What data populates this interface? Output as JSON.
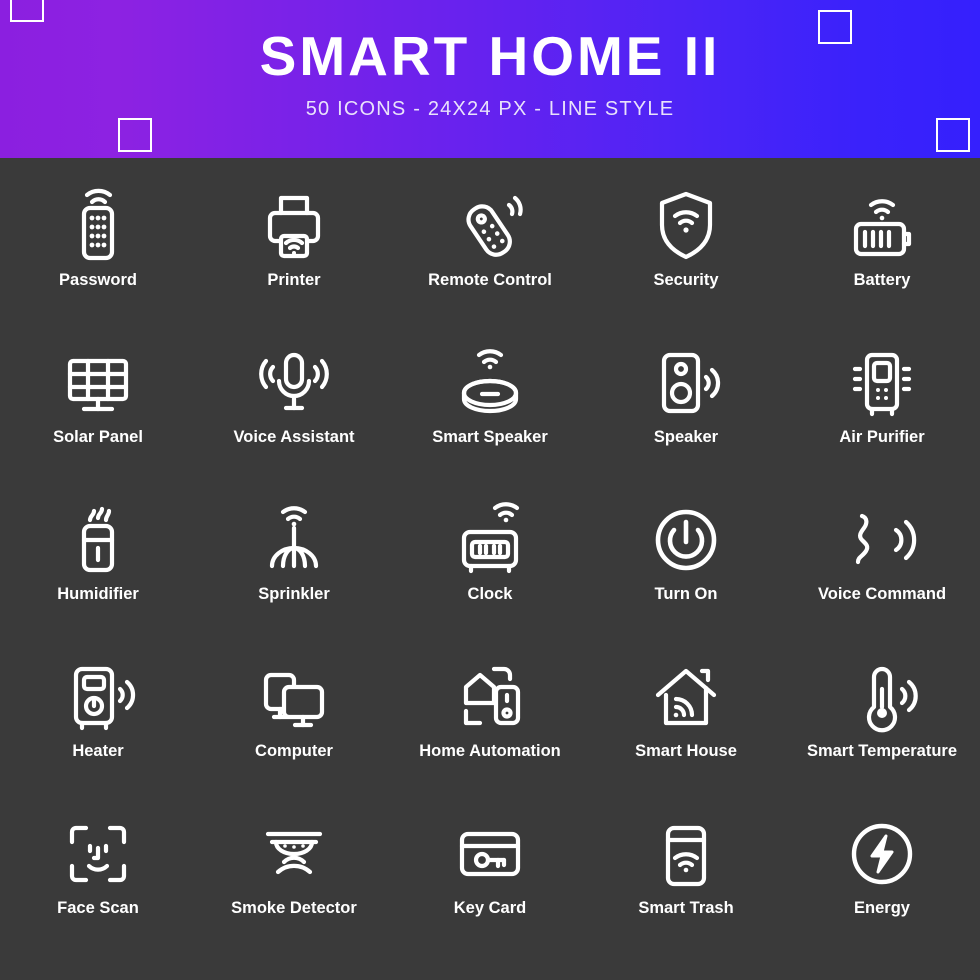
{
  "header": {
    "title": "SMART HOME II",
    "subtitle": "50 ICONS - 24X24 PX - LINE STYLE",
    "gradient_from": "#8b1fe0",
    "gradient_to": "#3520fd",
    "text_color": "#ffffff"
  },
  "theme": {
    "background": "#3a3a3a",
    "icon_color": "#ffffff",
    "label_color": "#ffffff"
  },
  "icons": [
    {
      "label": "Password",
      "icon": "password-icon"
    },
    {
      "label": "Printer",
      "icon": "printer-icon"
    },
    {
      "label": "Remote Control",
      "icon": "remote-control-icon"
    },
    {
      "label": "Security",
      "icon": "security-shield-icon"
    },
    {
      "label": "Battery",
      "icon": "battery-icon"
    },
    {
      "label": "Solar Panel",
      "icon": "solar-panel-icon"
    },
    {
      "label": "Voice Assistant",
      "icon": "voice-assistant-icon"
    },
    {
      "label": "Smart Speaker",
      "icon": "smart-speaker-icon"
    },
    {
      "label": "Speaker",
      "icon": "speaker-icon"
    },
    {
      "label": "Air Purifier",
      "icon": "air-purifier-icon"
    },
    {
      "label": "Humidifier",
      "icon": "humidifier-icon"
    },
    {
      "label": "Sprinkler",
      "icon": "sprinkler-icon"
    },
    {
      "label": "Clock",
      "icon": "clock-icon"
    },
    {
      "label": "Turn On",
      "icon": "power-icon"
    },
    {
      "label": "Voice Command",
      "icon": "voice-command-icon"
    },
    {
      "label": "Heater",
      "icon": "heater-icon"
    },
    {
      "label": "Computer",
      "icon": "computer-icon"
    },
    {
      "label": "Home Automation",
      "icon": "home-automation-icon"
    },
    {
      "label": "Smart House",
      "icon": "smart-house-icon"
    },
    {
      "label": "Smart Temperature",
      "icon": "smart-temperature-icon"
    },
    {
      "label": "Face Scan",
      "icon": "face-scan-icon"
    },
    {
      "label": "Smoke Detector",
      "icon": "smoke-detector-icon"
    },
    {
      "label": "Key Card",
      "icon": "key-card-icon"
    },
    {
      "label": "Smart Trash",
      "icon": "smart-trash-icon"
    },
    {
      "label": "Energy",
      "icon": "energy-icon"
    }
  ]
}
